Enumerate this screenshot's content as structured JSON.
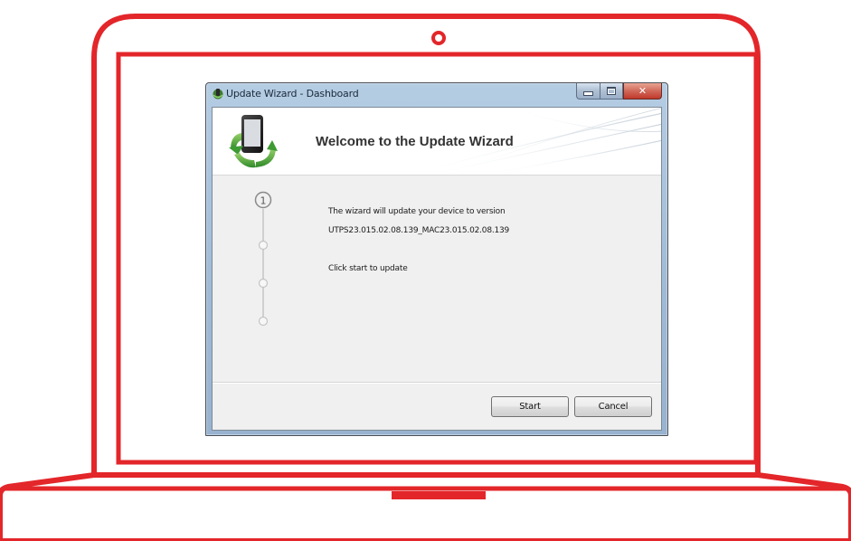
{
  "window": {
    "title": "Update Wizard - Dashboard"
  },
  "header": {
    "title": "Welcome to the Update Wizard",
    "icon": "device-update-icon"
  },
  "steps": {
    "current_label": "1",
    "total": 4,
    "current_index": 0
  },
  "body": {
    "line1": "The wizard will update your device to version",
    "version": "UTPS23.015.02.08.139_MAC23.015.02.08.139",
    "line3": "Click start to update"
  },
  "buttons": {
    "start": "Start",
    "cancel": "Cancel"
  },
  "colors": {
    "frame_red": "#e3262a",
    "accent_green": "#3e9b33"
  }
}
